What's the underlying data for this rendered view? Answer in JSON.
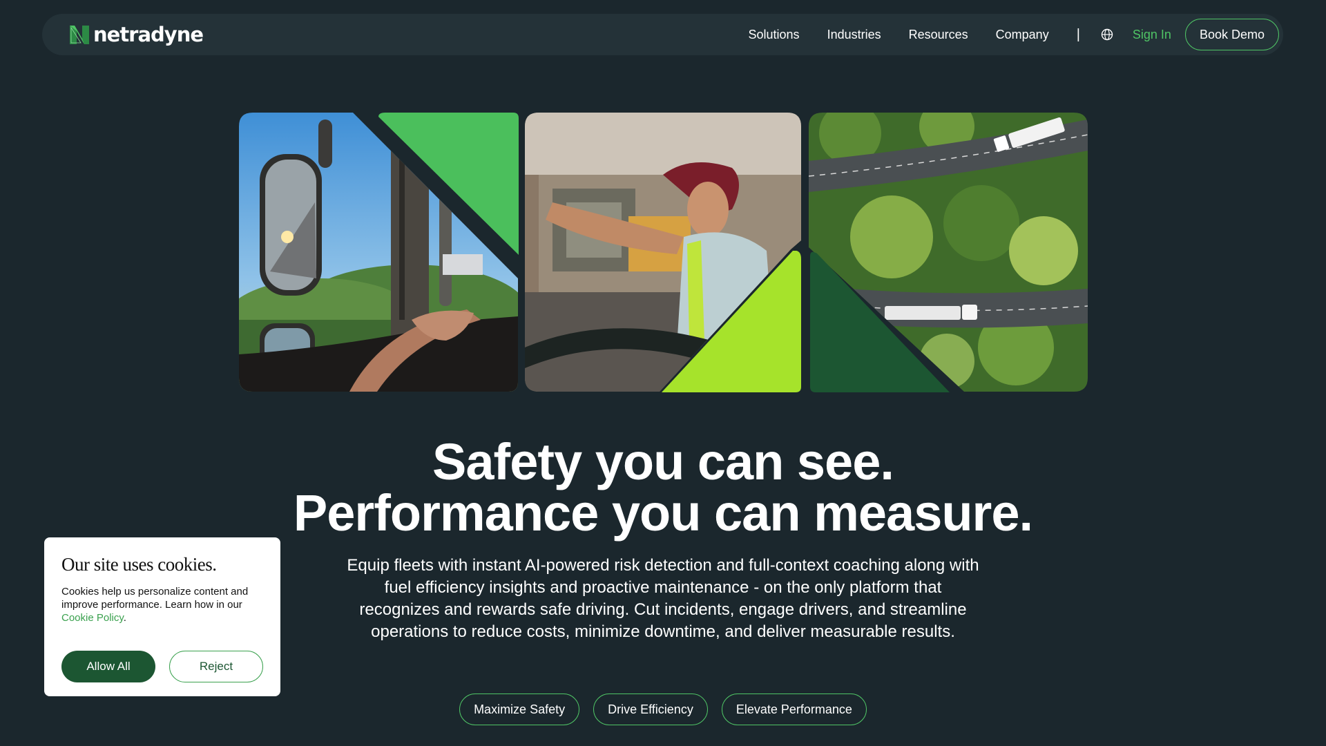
{
  "brand": {
    "name": "netradyne",
    "green": "#4fc465",
    "dark_green": "#1c5632",
    "lime": "#a6e32b",
    "bg": "#1b272d"
  },
  "nav": {
    "items": [
      {
        "label": "Solutions"
      },
      {
        "label": "Industries"
      },
      {
        "label": "Resources"
      },
      {
        "label": "Company"
      }
    ],
    "separator": "|",
    "globe_icon": "globe-icon",
    "sign_in": "Sign In",
    "book_demo": "Book Demo"
  },
  "hero": {
    "images": [
      {
        "name": "truck-mirror-steering-photo"
      },
      {
        "name": "female-driver-red-cap-photo"
      },
      {
        "name": "aerial-highway-trucks-forest-photo"
      }
    ],
    "headline_line1": "Safety you can see.",
    "headline_line2": "Performance you can measure.",
    "subtext": "Equip fleets with instant AI-powered risk detection and full-context coaching along with fuel efficiency insights and proactive maintenance - on the only platform that recognizes and rewards safe driving. Cut incidents, engage drivers, and streamline operations to reduce costs, minimize downtime, and deliver measurable results.",
    "pills": [
      {
        "label": "Maximize Safety"
      },
      {
        "label": "Drive Efficiency"
      },
      {
        "label": "Elevate Performance"
      }
    ]
  },
  "cookie": {
    "title": "Our site uses cookies.",
    "body": "Cookies help us personalize content and improve performance. Learn how in our ",
    "link": "Cookie Policy",
    "period": ".",
    "allow": "Allow All",
    "reject": "Reject"
  }
}
